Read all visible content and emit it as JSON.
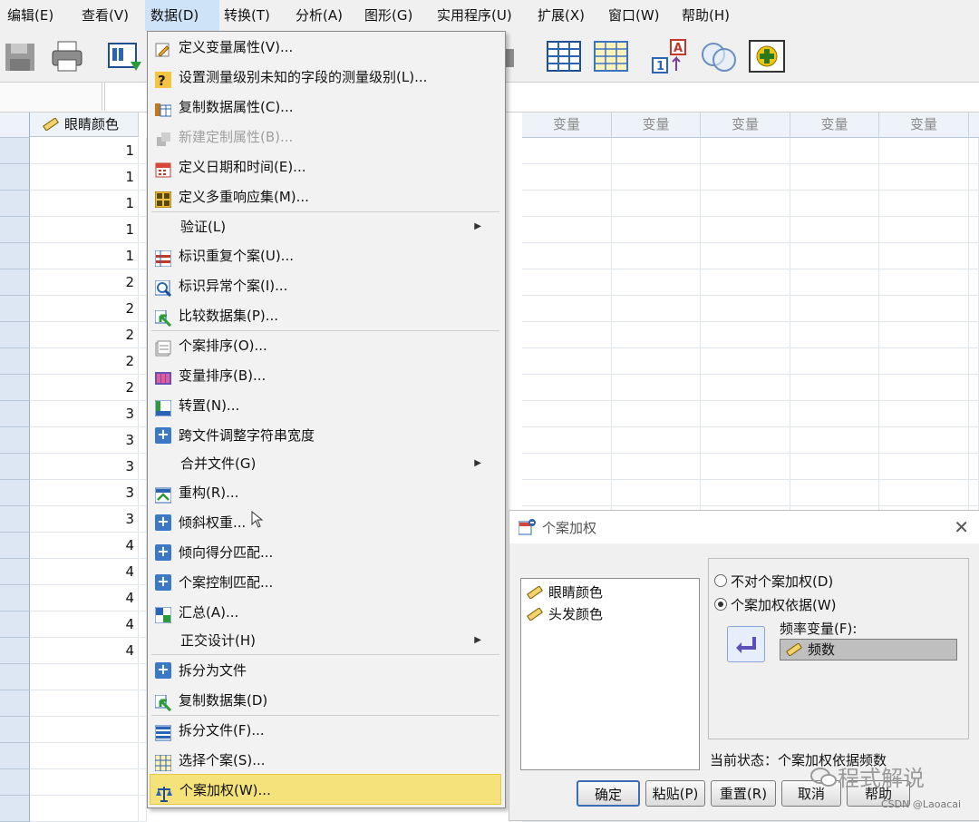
{
  "menubar": {
    "items": [
      {
        "label": "编辑(E)"
      },
      {
        "label": "查看(V)"
      },
      {
        "label": "数据(D)"
      },
      {
        "label": "转换(T)"
      },
      {
        "label": "分析(A)"
      },
      {
        "label": "图形(G)"
      },
      {
        "label": "实用程序(U)"
      },
      {
        "label": "扩展(X)"
      },
      {
        "label": "窗口(W)"
      },
      {
        "label": "帮助(H)"
      }
    ],
    "active": "数据(D)"
  },
  "grid": {
    "first_column": "眼睛颜色",
    "variable_header": "变量",
    "values": [
      "1",
      "1",
      "1",
      "1",
      "1",
      "2",
      "2",
      "2",
      "2",
      "2",
      "3",
      "3",
      "3",
      "3",
      "3",
      "4",
      "4",
      "4",
      "4",
      "4"
    ]
  },
  "data_menu": {
    "items": [
      {
        "label": "定义变量属性(V)...",
        "icon": "define-properties-icon"
      },
      {
        "label": "设置测量级别未知的字段的测量级别(L)...",
        "icon": "measurement-level-icon"
      },
      {
        "label": "复制数据属性(C)...",
        "icon": "copy-properties-icon"
      },
      {
        "label": "新建定制属性(B)...",
        "icon": "custom-attribute-icon",
        "disabled": true
      },
      {
        "label": "定义日期和时间(E)...",
        "icon": "calendar-icon"
      },
      {
        "label": "定义多重响应集(M)...",
        "icon": "multi-response-icon"
      },
      {
        "label": "验证(L)",
        "submenu": true
      },
      {
        "label": "标识重复个案(U)...",
        "icon": "duplicate-cases-icon"
      },
      {
        "label": "标识异常个案(I)...",
        "icon": "unusual-cases-icon"
      },
      {
        "label": "比较数据集(P)...",
        "icon": "compare-datasets-icon"
      },
      {
        "label": "个案排序(O)...",
        "icon": "sort-cases-icon"
      },
      {
        "label": "变量排序(B)...",
        "icon": "sort-variables-icon"
      },
      {
        "label": "转置(N)...",
        "icon": "transpose-icon"
      },
      {
        "label": "跨文件调整字符串宽度",
        "icon": "plus-icon"
      },
      {
        "label": "合并文件(G)",
        "submenu": true
      },
      {
        "label": "重构(R)...",
        "icon": "restructure-icon"
      },
      {
        "label": "倾斜权重...",
        "icon": "plus-icon"
      },
      {
        "label": "倾向得分匹配...",
        "icon": "plus-icon"
      },
      {
        "label": "个案控制匹配...",
        "icon": "plus-icon"
      },
      {
        "label": "汇总(A)...",
        "icon": "aggregate-icon"
      },
      {
        "label": "正交设计(H)",
        "submenu": true
      },
      {
        "label": "拆分为文件",
        "icon": "plus-icon"
      },
      {
        "label": "复制数据集(D)",
        "icon": "copy-dataset-icon"
      },
      {
        "label": "拆分文件(F)...",
        "icon": "split-file-icon"
      },
      {
        "label": "选择个案(S)...",
        "icon": "select-cases-icon"
      },
      {
        "label": "个案加权(W)...",
        "icon": "weight-cases-icon",
        "highlighted": true
      }
    ]
  },
  "dialog": {
    "title": "个案加权",
    "variables": [
      "眼睛颜色",
      "头发颜色"
    ],
    "radio_no_weight": "不对个案加权(D)",
    "radio_weight_by": "个案加权依据(W)",
    "selected_option": "个案加权依据(W)",
    "freq_label": "频率变量(F):",
    "freq_value": "频数",
    "status": "当前状态：个案加权依据频数",
    "buttons": {
      "ok": "确定",
      "paste": "粘贴(P)",
      "reset": "重置(R)",
      "cancel": "取消",
      "help": "帮助"
    }
  },
  "watermark": "程式解说",
  "source_tag": "CSDN @Laoacai"
}
